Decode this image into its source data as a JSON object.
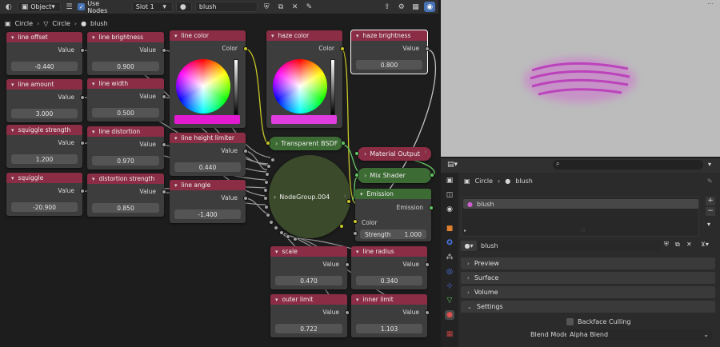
{
  "header": {
    "editor_type_icon": "node-editor-icon",
    "mode": "Object",
    "use_nodes_label": "Use Nodes",
    "slot": "Slot 1",
    "material_name": "blush"
  },
  "breadcrumb": {
    "items": [
      "Circle",
      "Circle",
      "blush"
    ]
  },
  "value_nodes": [
    {
      "title": "line offset",
      "out": "Value",
      "value": "-0.440"
    },
    {
      "title": "line amount",
      "out": "Value",
      "value": "3.000"
    },
    {
      "title": "squiggle strength",
      "out": "Value",
      "value": "1.200"
    },
    {
      "title": "squiggle",
      "out": "Value",
      "value": "-20.900"
    },
    {
      "title": "line brightness",
      "out": "Value",
      "value": "0.900"
    },
    {
      "title": "line width",
      "out": "Value",
      "value": "0.500"
    },
    {
      "title": "line distortion",
      "out": "Value",
      "value": "0.970"
    },
    {
      "title": "distortion strength",
      "out": "Value",
      "value": "0.850"
    },
    {
      "title": "line height limiter",
      "out": "Value",
      "value": "0.440"
    },
    {
      "title": "line angle",
      "out": "Value",
      "value": "-1.400"
    },
    {
      "title": "haze brightness",
      "out": "Value",
      "value": "0.800"
    },
    {
      "title": "scale",
      "out": "Value",
      "value": "0.470"
    },
    {
      "title": "line radius",
      "out": "Value",
      "value": "0.340"
    },
    {
      "title": "outer limit",
      "out": "Value",
      "value": "0.722"
    },
    {
      "title": "inner limit",
      "out": "Value",
      "value": "1.103"
    }
  ],
  "color_nodes": [
    {
      "title": "line color",
      "out": "Color",
      "swatch": "#e21bd0"
    },
    {
      "title": "haze color",
      "out": "Color",
      "swatch": "#e03de0"
    }
  ],
  "shader_nodes": {
    "transparent": "Transparent BSDF",
    "material_output": "Material Output",
    "mix_shader": "Mix Shader",
    "emission": "Emission",
    "emission_out": "Emission",
    "emission_color": "Color",
    "emission_strength_label": "Strength",
    "emission_strength_value": "1.000",
    "group": "NodeGroup.004"
  },
  "props": {
    "breadcrumb": [
      "Circle",
      "blush"
    ],
    "slot_item": "blush",
    "material_field": "blush",
    "sections": [
      "Preview",
      "Surface",
      "Volume",
      "Settings"
    ],
    "backface_culling": "Backface Culling",
    "blend_mode_label": "Blend Mode",
    "blend_mode_value": "Alpha Blend"
  },
  "colors": {
    "header_red": "#8b2d45",
    "shader_green": "#3d6b34",
    "group_green": "#3b4a2a",
    "accent_blue": "#4772b3"
  }
}
